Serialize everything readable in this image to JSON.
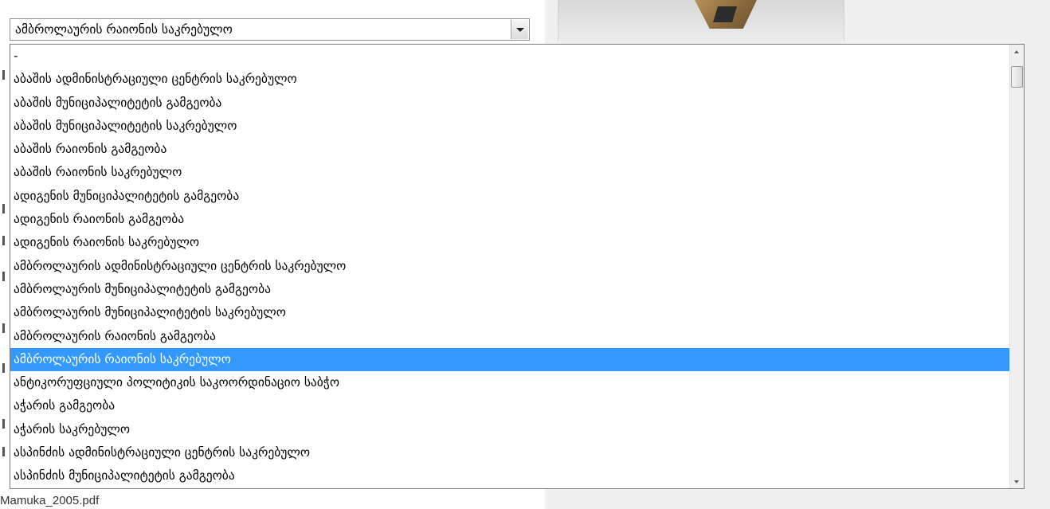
{
  "select": {
    "value": "ამბროლაურის რაიონის საკრებულო"
  },
  "dropdown": {
    "options": [
      "-",
      "აბაშის ადმინისტრაციული ცენტრის საკრებულო",
      "აბაშის მუნიციპალიტეტის გამგეობა",
      "აბაშის მუნიციპალიტეტის საკრებულო",
      "აბაშის რაიონის გამგეობა",
      "აბაშის რაიონის საკრებულო",
      "ადიგენის მუნიციპალიტეტის გამგეობა",
      "ადიგენის რაიონის გამგეობა",
      "ადიგენის რაიონის საკრებულო",
      "ამბროლაურის ადმინისტრაციული ცენტრის საკრებულო",
      "ამბროლაურის მუნიციპალიტეტის გამგეობა",
      "ამბროლაურის მუნიციპალიტეტის საკრებულო",
      "ამბროლაურის რაიონის გამგეობა",
      "ამბროლაურის რაიონის საკრებულო",
      "ანტიკორუფციული პოლიტიკის საკოორდინაციო საბჭო",
      "აჭარის გამგეობა",
      "აჭარის საკრებულო",
      "ასპინძის ადმინისტრაციული ცენტრის საკრებულო",
      "ასპინძის მუნიციპალიტეტის გამგეობა"
    ],
    "selected_index": 13
  },
  "background": {
    "filename": "Mamuka_2005.pdf"
  },
  "colors": {
    "selection": "#3399ff",
    "selection_text": "#ffffff"
  },
  "icons": {
    "select_arrow": "chevron-down-icon",
    "scroll_up": "scroll-up-icon",
    "scroll_down": "scroll-down-icon"
  }
}
